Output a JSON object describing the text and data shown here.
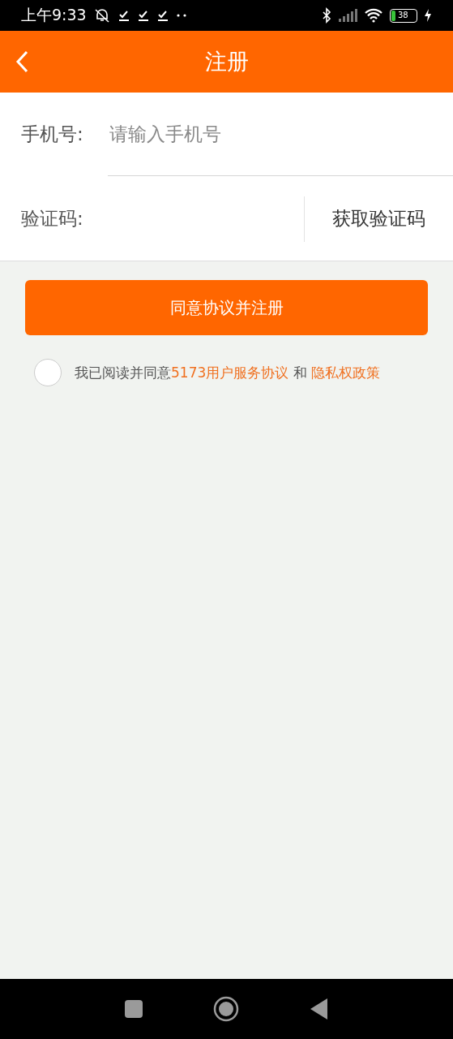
{
  "status_bar": {
    "time": "上午9:33",
    "battery": "38"
  },
  "header": {
    "title": "注册"
  },
  "form": {
    "phone": {
      "label": "手机号:",
      "placeholder": "请输入手机号"
    },
    "code": {
      "label": "验证码:",
      "button": "获取验证码"
    }
  },
  "submit_button": "同意协议并注册",
  "agreement": {
    "checked": false,
    "text_before": "我已阅读并同意",
    "link_1": "5173用户服务协议",
    "conjunction": "和",
    "link_2": "隐私权政策"
  }
}
